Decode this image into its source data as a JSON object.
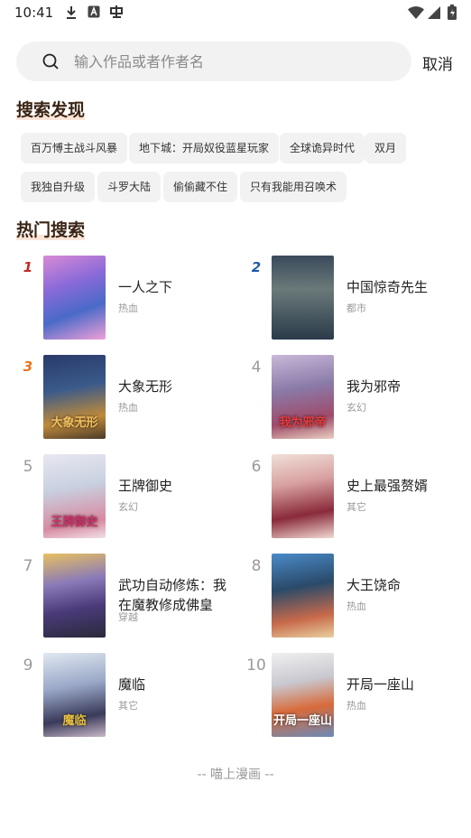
{
  "status_bar": {
    "time": "10:41",
    "notif_icons": [
      "download-icon",
      "font-icon",
      "app-icon"
    ],
    "system_icons": [
      "wifi-icon",
      "signal-icon",
      "battery-icon"
    ]
  },
  "search": {
    "placeholder": "输入作品或者作者名",
    "value": "",
    "cancel_label": "取消"
  },
  "discover": {
    "title": "搜索发现",
    "tags": [
      "百万愽主战斗风暴",
      "地下城：开局奴役蓝星玩家",
      "全球诡异时代",
      "双月",
      "我独自升级",
      "斗罗大陆",
      "偷偷藏不住",
      "只有我能用召唤术"
    ]
  },
  "hot": {
    "title": "热门搜索",
    "items": [
      {
        "rank": "1",
        "title": "一人之下",
        "genre": "热血",
        "cover_text": ""
      },
      {
        "rank": "2",
        "title": "中国惊奇先生",
        "genre": "都市",
        "cover_text": ""
      },
      {
        "rank": "3",
        "title": "大象无形",
        "genre": "热血",
        "cover_text": "大象无形"
      },
      {
        "rank": "4",
        "title": "我为邪帝",
        "genre": "玄幻",
        "cover_text": "我为邪帝"
      },
      {
        "rank": "5",
        "title": "王牌御史",
        "genre": "玄幻",
        "cover_text": "王牌御史"
      },
      {
        "rank": "6",
        "title": "史上最强赘婿",
        "genre": "其它",
        "cover_text": ""
      },
      {
        "rank": "7",
        "title": "武功自动修炼：我在魔教修成佛皇",
        "genre": "穿越",
        "cover_text": ""
      },
      {
        "rank": "8",
        "title": "大王饶命",
        "genre": "热血",
        "cover_text": ""
      },
      {
        "rank": "9",
        "title": "魔临",
        "genre": "其它",
        "cover_text": "魔临"
      },
      {
        "rank": "10",
        "title": "开局一座山",
        "genre": "热血",
        "cover_text": "开局一座山"
      }
    ]
  },
  "footer": {
    "text": "-- 喵上漫画 --"
  },
  "colors": {
    "rank1": "#c62828",
    "rank2": "#1e5aa8",
    "rank3": "#e8731c",
    "tag_bg": "#f2f2f2",
    "section_title": "#3a2414"
  }
}
